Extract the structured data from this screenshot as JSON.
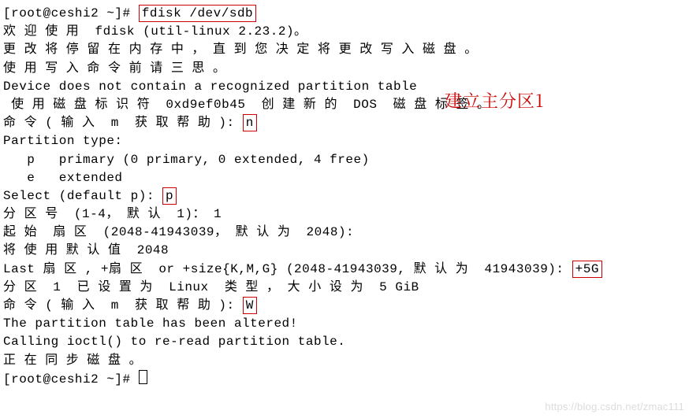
{
  "prompt1": "[root@ceshi2 ~]# ",
  "cmd_fdisk": "fdisk /dev/sdb",
  "l_welcome": "欢 迎 使 用  fdisk (util-linux 2.23.2)。",
  "blank": "",
  "l_mem": "更 改 将 停 留 在 内 存 中 ， 直 到 您 决 定 将 更 改 写 入 磁 盘 。",
  "l_think": "使 用 写 入 命 令 前 请 三 思 。",
  "l_devtbl": "Device does not contain a recognized partition table",
  "l_doslabel": " 使 用 磁 盘 标 识 符  0xd9ef0b45  创 建 新 的  DOS  磁 盘 标 签 。",
  "l_cmd_prompt": "命 令 ( 输 入  m  获 取 帮 助 ): ",
  "n_val": "n",
  "l_ptype": "Partition type:",
  "l_primary": "   p   primary (0 primary, 0 extended, 4 free)",
  "l_extended": "   e   extended",
  "l_select": "Select (default p): ",
  "p_val": "p",
  "l_partnum": "分 区 号  (1-4， 默 认  1)： 1",
  "l_first": "起 始  扇 区  (2048-41943039， 默 认 为  2048):",
  "l_default": "将 使 用 默 认 值  2048",
  "l_last_pre": "Last 扇 区 , +扇 区  or +size{K,M,G} (2048-41943039, 默 认 为  41943039): ",
  "size_val": "+5G",
  "l_setlinux": "分 区  1  已 设 置 为  Linux  类 型 ， 大 小 设 为  5 GiB",
  "w_val": "W",
  "l_altered": "The partition table has been altered!",
  "l_ioctl": "Calling ioctl() to re-read partition table.",
  "l_sync": "正 在 同 步 磁 盘 。",
  "prompt2": "[root@ceshi2 ~]# ",
  "annotation": "建立主分区1",
  "watermark": "https://blog.csdn.net/zmac111"
}
